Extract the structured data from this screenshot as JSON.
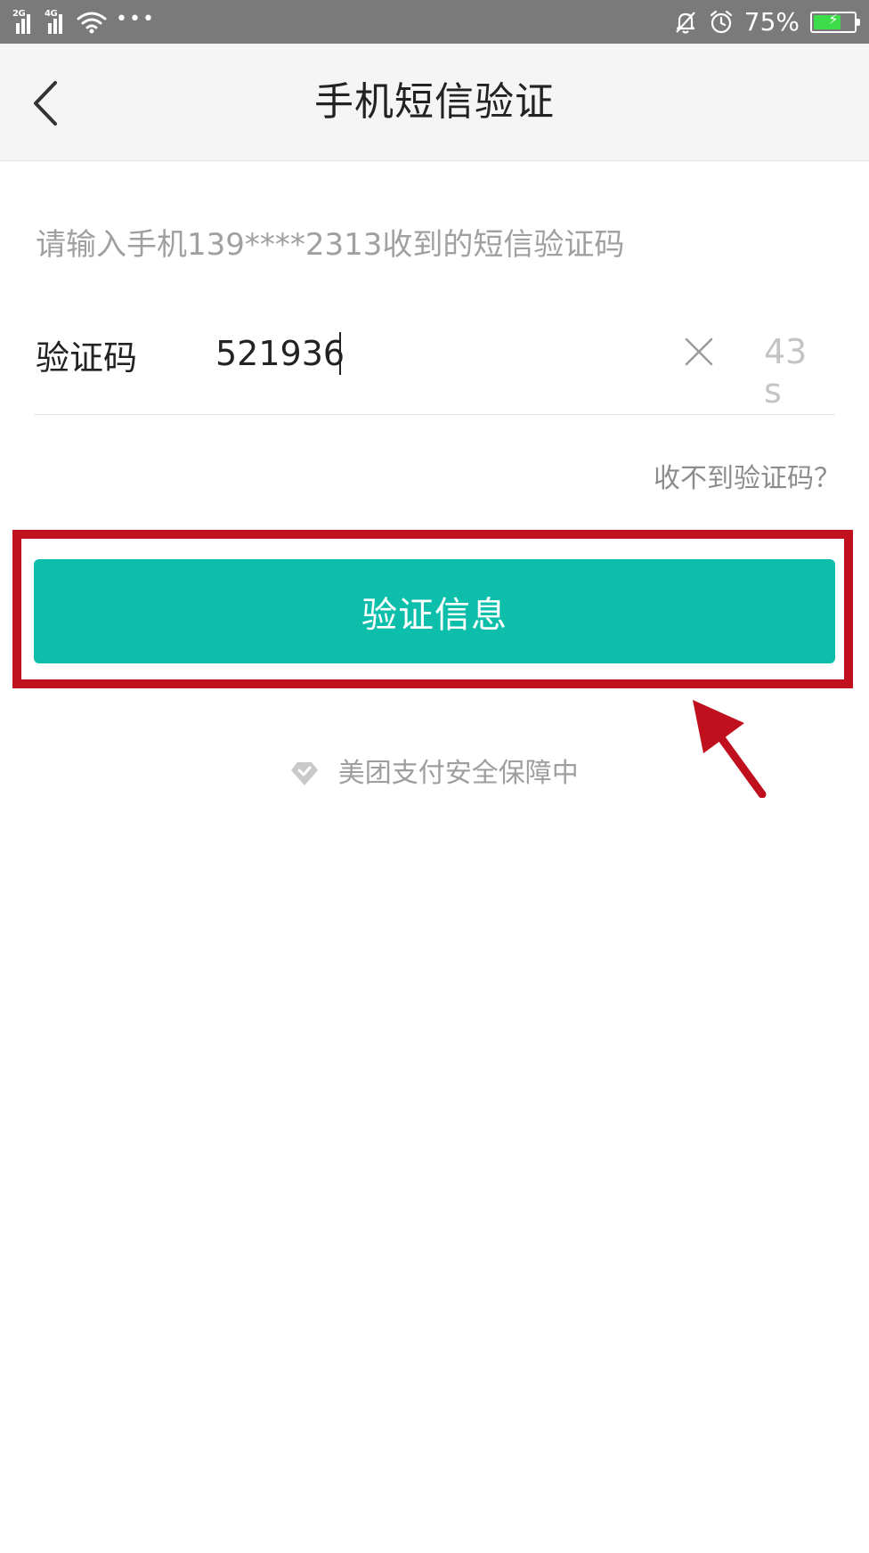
{
  "status_bar": {
    "network_1": "2G",
    "network_2": "4G",
    "more_dots": "•••",
    "battery_percent": "75%",
    "battery_level": 0.75,
    "icons": [
      "signal-2g-icon",
      "signal-4g-icon",
      "wifi-icon",
      "more-icon",
      "mute-icon",
      "alarm-icon",
      "battery-charging-icon"
    ]
  },
  "nav": {
    "title": "手机短信验证",
    "back_icon": "chevron-left-icon"
  },
  "form": {
    "hint": "请输入手机139****2313收到的短信验证码",
    "code_label": "验证码",
    "code_value": "521936",
    "clear_icon": "close-icon",
    "countdown": "43 s",
    "no_code_link": "收不到验证码？",
    "submit_label": "验证信息"
  },
  "footer": {
    "security_text": "美团支付安全保障中",
    "security_icon": "shield-icon"
  },
  "annotation": {
    "highlight_color": "#c0101e",
    "arrow_icon": "pointer-arrow-icon"
  },
  "colors": {
    "accent": "#0dbfab",
    "status_bar": "#7a7a7a",
    "nav_bg": "#f5f5f5"
  }
}
